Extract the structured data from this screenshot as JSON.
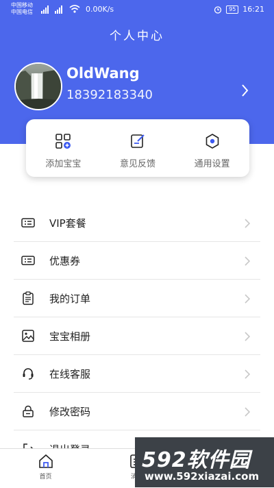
{
  "status_bar": {
    "carrier_1": "中国移动",
    "carrier_2": "中国电信",
    "net_speed": "0.00K/s",
    "battery": "95",
    "time": "16:21"
  },
  "header": {
    "title": "个人中心"
  },
  "profile": {
    "username": "OldWang",
    "phone": "18392183340"
  },
  "quick_actions": [
    {
      "label": "添加宝宝",
      "icon": "add-apps-icon"
    },
    {
      "label": "意见反馈",
      "icon": "feedback-edit-icon"
    },
    {
      "label": "通用设置",
      "icon": "settings-hexagon-icon"
    }
  ],
  "menu": {
    "items": [
      {
        "label": "VIP套餐",
        "icon": "card-icon"
      },
      {
        "label": "优惠券",
        "icon": "coupon-icon"
      },
      {
        "label": "我的订单",
        "icon": "clipboard-icon"
      },
      {
        "label": "宝宝相册",
        "icon": "image-icon"
      },
      {
        "label": "在线客服",
        "icon": "headset-icon"
      },
      {
        "label": "修改密码",
        "icon": "lock-icon"
      },
      {
        "label": "退出登录",
        "icon": "logout-icon"
      }
    ]
  },
  "bottom_nav": {
    "home": "首页",
    "second": "消息"
  },
  "watermark": {
    "line1": "592软件园",
    "line2": "www.592xiazai.com"
  },
  "colors": {
    "brand": "#4c67ec",
    "icon_blue": "#3d5af1"
  }
}
